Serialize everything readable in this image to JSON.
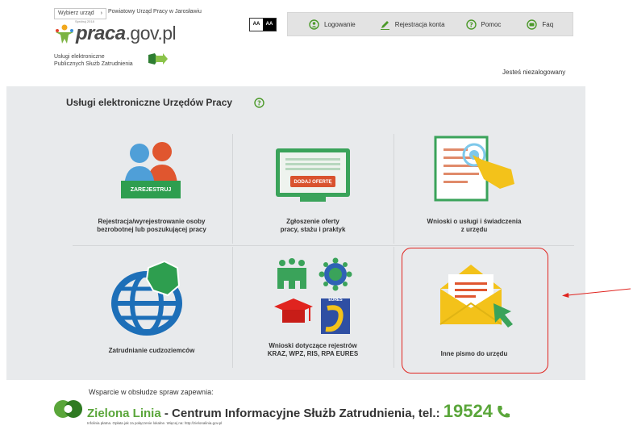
{
  "header": {
    "choose_office": "Wybierz urząd",
    "office_name": "Powiatowy Urząd Pracy w Jarosławiu",
    "logo_tiny": "Spróbuj 2018",
    "logo_main": "praca",
    "logo_domain": ".gov.pl",
    "services_line1": "Usługi elektroniczne",
    "services_line2": "Publicznych Służb Zatrudnienia",
    "contrast_a1": "AA",
    "contrast_a2": "AA",
    "status": "Jesteś niezalogowany"
  },
  "nav": {
    "login": "Logowanie",
    "register": "Rejestracja konta",
    "help": "Pomoc",
    "faq": "Faq"
  },
  "main": {
    "title": "Usługi elektroniczne Urzędów Pracy",
    "tiles": [
      {
        "line1": "Rejestracja/wyrejestrowanie osoby",
        "line2": "bezrobotnej lub poszukującej pracy",
        "badge": "ZAREJESTRUJ"
      },
      {
        "line1": "Zgłoszenie oferty",
        "line2": "pracy, stażu i praktyk",
        "badge": "DODAJ OFERTĘ"
      },
      {
        "line1": "Wnioski o usługi i świadczenia",
        "line2": "z urzędu"
      },
      {
        "line1": "Zatrudnianie cudzoziemców",
        "line2": ""
      },
      {
        "line1": "Wnioski dotyczące rejestrów",
        "line2": "KRAZ, WPZ, RIS, RPA EURES",
        "badge": "EURES"
      },
      {
        "line1": "Inne pismo do urzędu",
        "line2": ""
      }
    ]
  },
  "footer": {
    "support": "Wsparcie w obsłudze spraw zapewnia:",
    "zl_name": "Zielona Linia",
    "zl_desc": " - Centrum Informacyjne Służb Zatrudnienia, tel.: ",
    "zl_phone": "19524",
    "zl_small": "Infolinia płatna. Opłata jak za połączenie lokalne. Więcej na: http://zielonalinia.gov.pl"
  },
  "colors": {
    "green": "#5aa63a",
    "highlight": "#e0241f",
    "panel": "#e8eaec"
  }
}
